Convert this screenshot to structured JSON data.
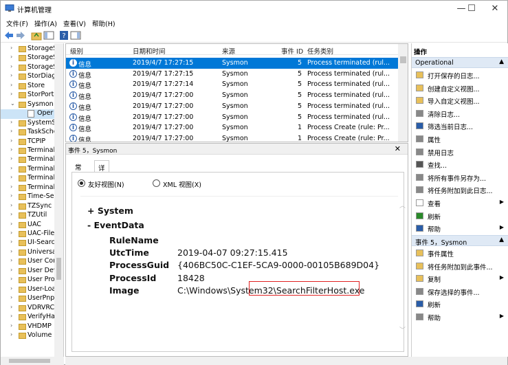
{
  "window": {
    "title": "计算机管理",
    "minimize": "—",
    "maximize": "☐",
    "close": "✕"
  },
  "menu": [
    "文件(F)",
    "操作(A)",
    "查看(V)",
    "帮助(H)"
  ],
  "tree": {
    "items": [
      {
        "label": "StorageS",
        "arrow": "›"
      },
      {
        "label": "StorageS",
        "arrow": "›"
      },
      {
        "label": "StorageS",
        "arrow": "›"
      },
      {
        "label": "StorDiag",
        "arrow": "›"
      },
      {
        "label": "Store",
        "arrow": "›"
      },
      {
        "label": "StorPort",
        "arrow": "›"
      },
      {
        "label": "Sysmon",
        "arrow": "⌄"
      },
      {
        "label": "Oper",
        "arrow": ""
      },
      {
        "label": "SystemS",
        "arrow": "›"
      },
      {
        "label": "TaskSche",
        "arrow": "›"
      },
      {
        "label": "TCPIP",
        "arrow": "›"
      },
      {
        "label": "Terminal",
        "arrow": "›"
      },
      {
        "label": "Terminal",
        "arrow": "›"
      },
      {
        "label": "Terminal",
        "arrow": "›"
      },
      {
        "label": "Terminal",
        "arrow": "›"
      },
      {
        "label": "Terminal",
        "arrow": "›"
      },
      {
        "label": "Time-Se",
        "arrow": "›"
      },
      {
        "label": "TZSync",
        "arrow": "›"
      },
      {
        "label": "TZUtil",
        "arrow": "›"
      },
      {
        "label": "UAC",
        "arrow": "›"
      },
      {
        "label": "UAC-File",
        "arrow": "›"
      },
      {
        "label": "UI-Searc",
        "arrow": "›"
      },
      {
        "label": "Universa",
        "arrow": "›"
      },
      {
        "label": "User Cor",
        "arrow": "›"
      },
      {
        "label": "User Dev",
        "arrow": "›"
      },
      {
        "label": "User Pro",
        "arrow": "›"
      },
      {
        "label": "User-Loa",
        "arrow": "›"
      },
      {
        "label": "UserPnp",
        "arrow": "›"
      },
      {
        "label": "VDRVRC",
        "arrow": "›"
      },
      {
        "label": "VerifyHa",
        "arrow": "›"
      },
      {
        "label": "VHDMP",
        "arrow": "›"
      },
      {
        "label": "Volume",
        "arrow": "›"
      }
    ]
  },
  "list": {
    "columns": [
      "级别",
      "日期和时间",
      "来源",
      "事件 ID",
      "任务类别"
    ],
    "rows": [
      {
        "level": "信息",
        "time": "2019/4/7 17:27:15",
        "source": "Sysmon",
        "id": "5",
        "task": "Process terminated (rul..."
      },
      {
        "level": "信息",
        "time": "2019/4/7 17:27:15",
        "source": "Sysmon",
        "id": "5",
        "task": "Process terminated (rul..."
      },
      {
        "level": "信息",
        "time": "2019/4/7 17:27:14",
        "source": "Sysmon",
        "id": "5",
        "task": "Process terminated (rul..."
      },
      {
        "level": "信息",
        "time": "2019/4/7 17:27:00",
        "source": "Sysmon",
        "id": "5",
        "task": "Process terminated (rul..."
      },
      {
        "level": "信息",
        "time": "2019/4/7 17:27:00",
        "source": "Sysmon",
        "id": "5",
        "task": "Process terminated (rul..."
      },
      {
        "level": "信息",
        "time": "2019/4/7 17:27:00",
        "source": "Sysmon",
        "id": "5",
        "task": "Process terminated (rul..."
      },
      {
        "level": "信息",
        "time": "2019/4/7 17:27:00",
        "source": "Sysmon",
        "id": "1",
        "task": "Process Create (rule: Pr..."
      },
      {
        "level": "信息",
        "time": "2019/4/7 17:27:00",
        "source": "Sysmon",
        "id": "1",
        "task": "Process Create (rule: Pr..."
      }
    ]
  },
  "details": {
    "header": "事件 5，Sysmon",
    "close": "✕",
    "tabs": [
      "常规",
      "详细信息"
    ],
    "radio_friendly": "友好视图(N)",
    "radio_xml": "XML 视图(X)",
    "system_label": "+ System",
    "eventdata_label": "-  EventData",
    "fields": [
      {
        "key": "RuleName",
        "value": ""
      },
      {
        "key": "UtcTime",
        "value": "2019-04-07 09:27:15.415"
      },
      {
        "key": "ProcessGuid",
        "value": "{406BC50C-C1EF-5CA9-0000-00105B689D04}"
      },
      {
        "key": "ProcessId",
        "value": "18428"
      },
      {
        "key": "Image",
        "value": "C:\\Windows\\System32\\SearchFilterHost.exe"
      }
    ]
  },
  "actions": {
    "title": "操作",
    "section1": "Operational",
    "items1": [
      {
        "label": "打开保存的日志...",
        "sub": ""
      },
      {
        "label": "创建自定义视图...",
        "sub": ""
      },
      {
        "label": "导入自定义视图...",
        "sub": ""
      },
      {
        "label": "清除日志...",
        "sub": ""
      },
      {
        "label": "筛选当前日志...",
        "sub": ""
      },
      {
        "label": "属性",
        "sub": ""
      },
      {
        "label": "禁用日志",
        "sub": ""
      },
      {
        "label": "查找...",
        "sub": ""
      },
      {
        "label": "将所有事件另存为...",
        "sub": ""
      },
      {
        "label": "将任务附加到此日志...",
        "sub": ""
      },
      {
        "label": "查看",
        "sub": "▶"
      },
      {
        "label": "刷新",
        "sub": ""
      },
      {
        "label": "帮助",
        "sub": "▶"
      }
    ],
    "section2": "事件 5，Sysmon",
    "items2": [
      {
        "label": "事件属性",
        "sub": ""
      },
      {
        "label": "将任务附加到此事件...",
        "sub": ""
      },
      {
        "label": "复制",
        "sub": "▶"
      },
      {
        "label": "保存选择的事件...",
        "sub": ""
      },
      {
        "label": "刷新",
        "sub": ""
      },
      {
        "label": "帮助",
        "sub": "▶"
      }
    ]
  }
}
